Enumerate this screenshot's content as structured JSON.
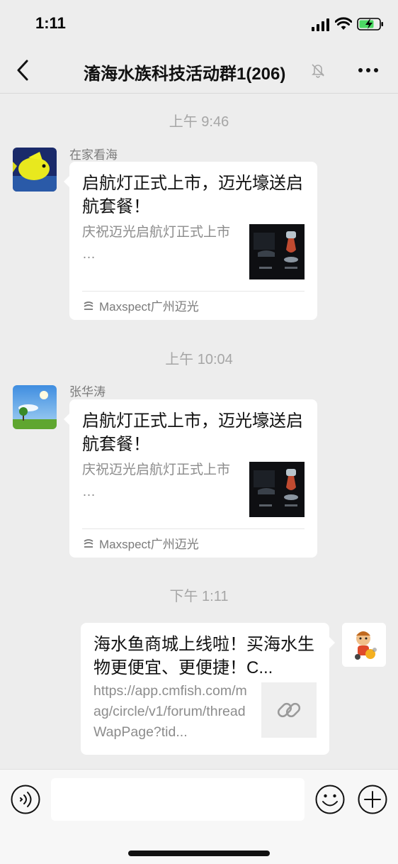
{
  "status_bar": {
    "time": "1:11"
  },
  "nav": {
    "title": "滀海水族科技活动群1(206)"
  },
  "colors": {
    "background": "#ededed",
    "bubble": "#ffffff",
    "meta_text": "#a6a6a6"
  },
  "messages": [
    {
      "timestamp": "上午 9:46",
      "sender": "在家看海",
      "avatar_icon": "yellow-tang-fish-avatar",
      "card": {
        "title": "启航灯正式上市，迈光壕送启航套餐！",
        "desc": "庆祝迈光启航灯正式上市\n…",
        "source": "Maxspect广州迈光",
        "source_icon": "maxspect-logo-icon"
      }
    },
    {
      "timestamp": "上午 10:04",
      "sender": "张华涛",
      "avatar_icon": "sky-landscape-avatar",
      "card": {
        "title": "启航灯正式上市，迈光壕送启航套餐！",
        "desc": "庆祝迈光启航灯正式上市\n…",
        "source": "Maxspect广州迈光",
        "source_icon": "maxspect-logo-icon"
      }
    },
    {
      "timestamp": "下午 1:11",
      "sender": "me",
      "avatar_icon": "cartoon-character-avatar",
      "card": {
        "title": "海水鱼商城上线啦！买海水生物更便宜、更便捷！C...",
        "url": "https://app.cmfish.com/mag/circle/v1/forum/threadWapPage?tid...",
        "thumb_icon": "link-icon"
      }
    }
  ],
  "input_bar": {
    "text": ""
  }
}
